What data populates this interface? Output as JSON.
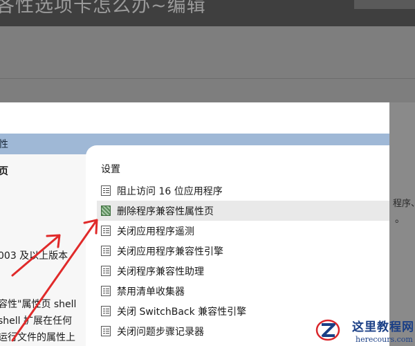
{
  "background": {
    "header_title": "各性选项卡怎么办",
    "header_suffix": "~编辑",
    "right_text": "程序、",
    "right_mark": "。"
  },
  "window": {
    "title": "性",
    "left_pane": {
      "lines": [
        "页",
        "003 及以上版本",
        "容性\"属性页 shell",
        "shell 扩展在任何",
        "运行文件的属性上"
      ]
    },
    "settings": {
      "label": "设置",
      "items": [
        {
          "label": "阻止访问 16 位应用程序",
          "icon": "policy-doc-icon",
          "selected": false
        },
        {
          "label": "删除程序兼容性属性页",
          "icon": "policy-selected-icon",
          "selected": true
        },
        {
          "label": "关闭应用程序遥测",
          "icon": "policy-doc-icon",
          "selected": false
        },
        {
          "label": "关闭应用程序兼容性引擎",
          "icon": "policy-doc-icon",
          "selected": false
        },
        {
          "label": "关闭程序兼容性助理",
          "icon": "policy-doc-icon",
          "selected": false
        },
        {
          "label": "禁用清单收集器",
          "icon": "policy-doc-icon",
          "selected": false
        },
        {
          "label": "关闭 SwitchBack 兼容性引擎",
          "icon": "policy-doc-icon",
          "selected": false
        },
        {
          "label": "关闭问题步骤记录器",
          "icon": "policy-doc-icon",
          "selected": false
        }
      ]
    }
  },
  "annotation": {
    "arrow_color": "#e02a2a"
  },
  "watermark": {
    "name": "这里教程网",
    "url": "herecours.com",
    "colors": {
      "primary": "#1a3f86",
      "accent": "#d9262c"
    }
  }
}
